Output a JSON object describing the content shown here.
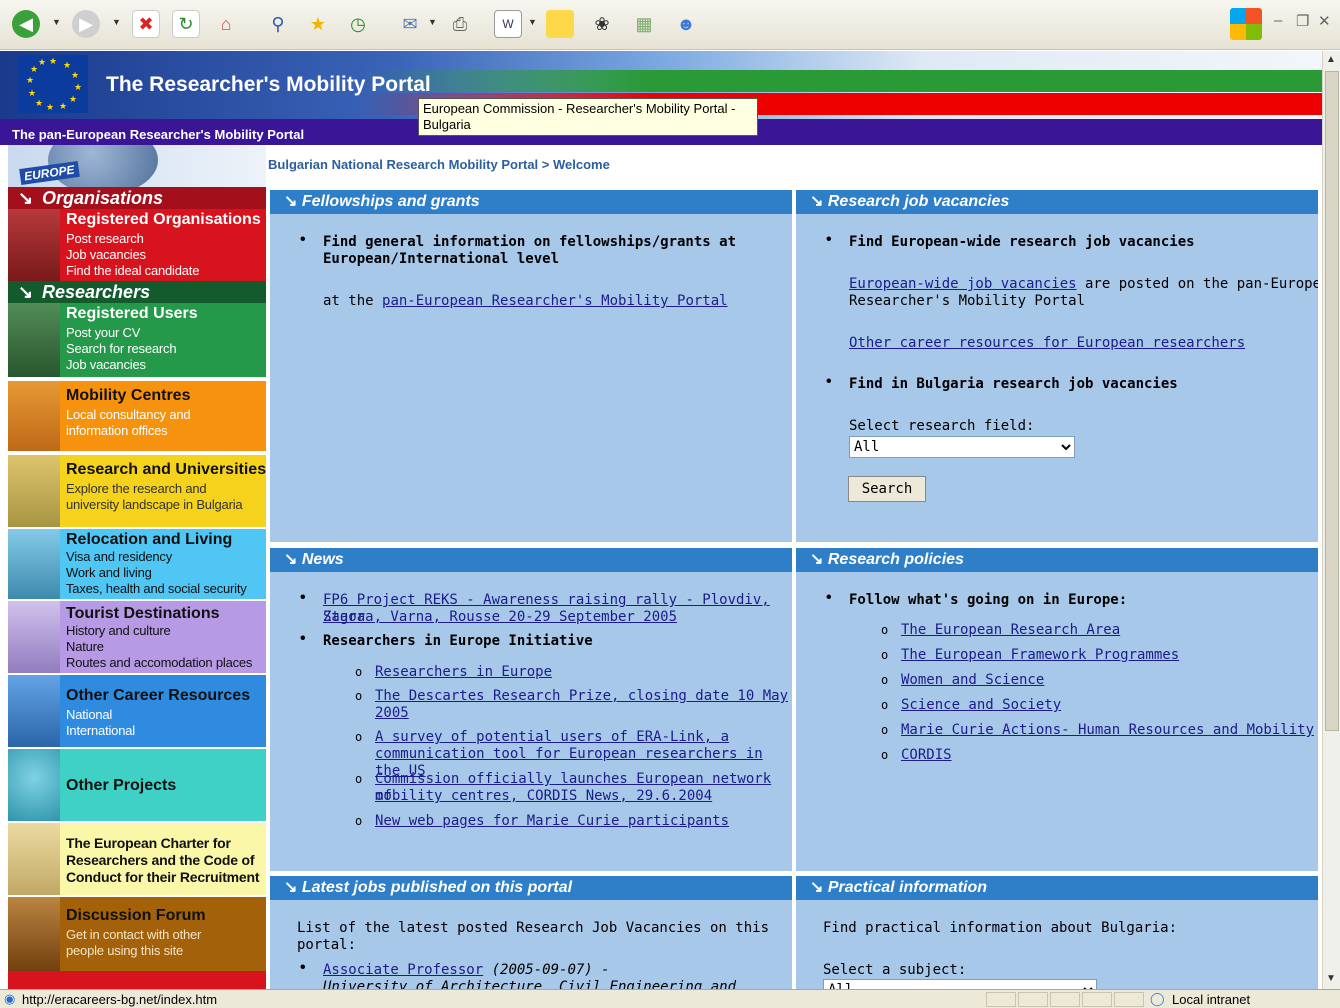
{
  "browser": {
    "status_url": "http://eracareers-bg.net/index.htm",
    "zone": "Local intranet",
    "tooltip": "European Commission - Researcher's Mobility Portal - Bulgaria"
  },
  "header": {
    "title": "The Researcher's Mobility Portal",
    "subtitle": "The pan-European Researcher's Mobility Portal",
    "europe_logo": "EUROPE"
  },
  "breadcrumb": "Bulgarian National Research Mobility Portal > Welcome",
  "sidebar": {
    "organisations": {
      "heading": "Organisations",
      "title": "Registered Organisations",
      "lines": [
        "Post research",
        "Job vacancies",
        "Find the ideal candidate"
      ]
    },
    "researchers": {
      "heading": "Researchers",
      "title": "Registered Users",
      "lines": [
        "Post your CV",
        "Search for research",
        "Job vacancies"
      ]
    },
    "mobility": {
      "title": "Mobility Centres",
      "lines": [
        "Local consultancy and",
        "information offices"
      ]
    },
    "research": {
      "title": "Research and Universities",
      "lines": [
        "Explore the research and",
        "university landscape in Bulgaria"
      ]
    },
    "relocation": {
      "title": "Relocation and Living",
      "lines": [
        "Visa and residency",
        "Work and living",
        "Taxes, health and social security"
      ]
    },
    "tourist": {
      "title": "Tourist Destinations",
      "lines": [
        "History and culture",
        "Nature",
        "Routes and accomodation places"
      ]
    },
    "career": {
      "title": "Other Career Resources",
      "lines": [
        "National",
        "International"
      ]
    },
    "projects": {
      "title": "Other Projects"
    },
    "charter": {
      "lines": [
        "The European Charter for",
        "Researchers and the Code of",
        "Conduct for their Recruitment"
      ]
    },
    "forum": {
      "title": "Discussion Forum",
      "lines": [
        "Get in contact with other",
        "people using this site"
      ]
    }
  },
  "panels": {
    "fellowships": {
      "heading": "Fellowships and grants",
      "bullet_lines": [
        "Find general information on fellowships/grants at",
        "European/International level"
      ],
      "at_text": "at the ",
      "link": "pan-European Researcher's Mobility Portal"
    },
    "vacancies": {
      "heading": "Research job vacancies",
      "bullet1": "Find European-wide research job vacancies",
      "ew_link": "European-wide job vacancies",
      "ew_rest1": " are posted on the pan-European",
      "ew_rest2": "Researcher's Mobility Portal",
      "other_link": "Other career resources for European researchers",
      "bullet2": "Find in Bulgaria research job vacancies",
      "select_label": "Select research field:",
      "select_value": "All",
      "search_label": "Search"
    },
    "news": {
      "heading": "News",
      "item1": [
        "FP6 Project REKS - Awareness raising rally - Plovdiv, Stara",
        "Zagora, Varna, Rousse 20-29 September 2005"
      ],
      "item2": "Researchers in Europe Initiative",
      "sub1": "Researchers in Europe",
      "sub2": [
        "The Descartes Research Prize, closing date 10 May",
        "2005"
      ],
      "sub3": [
        "A survey of potential users of ERA-Link, a",
        "communication tool for European researchers in the US"
      ],
      "sub4": [
        "Commission officially launches European network of",
        "mobility centres, CORDIS News, 29.6.2004"
      ],
      "sub5": "New web pages for Marie Curie participants"
    },
    "policies": {
      "heading": "Research policies",
      "bullet": "Follow what's going on in Europe:",
      "links": [
        "The European Research Area",
        "The European Framework Programmes",
        "Women and Science",
        "Science and Society",
        "Marie Curie Actions- Human Resources and Mobility",
        "CORDIS"
      ]
    },
    "latest": {
      "heading": "Latest jobs published on this portal",
      "intro": "List of the latest posted Research Job Vacancies on this portal:",
      "job_link": "Associate Professor",
      "job_date": " (2005-09-07) -",
      "job_org": "University of Architecture, Civil Engineering and Geodesy"
    },
    "practical": {
      "heading": "Practical information",
      "intro": "Find practical information about Bulgaria:",
      "select_label": "Select a subject:",
      "select_value": "All"
    }
  },
  "colors": {
    "panel_bg": "#a8c8ea",
    "panel_head": "#2f7fc8",
    "link": "#1c1c8a"
  }
}
